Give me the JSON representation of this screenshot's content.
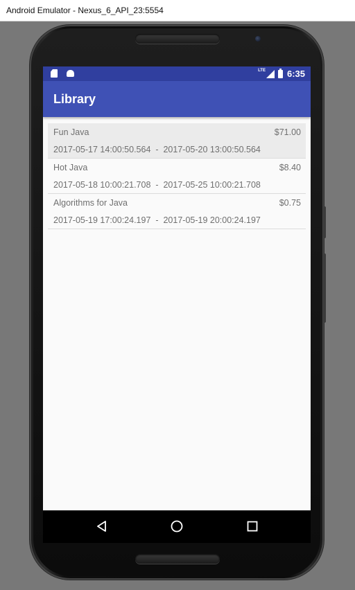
{
  "window": {
    "title": "Android Emulator - Nexus_6_API_23:5554"
  },
  "status_bar": {
    "network": "LTE",
    "time": "6:35",
    "left_icons": [
      "sd-card-icon",
      "android-icon"
    ],
    "right_icons": [
      "signal-icon",
      "battery-charging-icon"
    ]
  },
  "app_bar": {
    "title": "Library",
    "color": "#3f51b5"
  },
  "books": [
    {
      "title": "Fun Java",
      "price": "$71.00",
      "start": "2017-05-17 14:00:50.564",
      "end": "2017-05-20 13:00:50.564",
      "selected": true
    },
    {
      "title": "Hot Java",
      "price": "$8.40",
      "start": "2017-05-18 10:00:21.708",
      "end": "2017-05-25 10:00:21.708",
      "selected": false
    },
    {
      "title": "Algorithms for Java",
      "price": "$0.75",
      "start": "2017-05-19 17:00:24.197",
      "end": "2017-05-19 20:00:24.197",
      "selected": false
    }
  ],
  "date_separator": "-",
  "nav_bar": {
    "buttons": [
      "back-icon",
      "home-icon",
      "recents-icon"
    ]
  },
  "colors": {
    "status_bar": "#303f9f",
    "primary": "#3f51b5",
    "selected_row": "#ebebeb",
    "text": "#6f6f6f"
  }
}
